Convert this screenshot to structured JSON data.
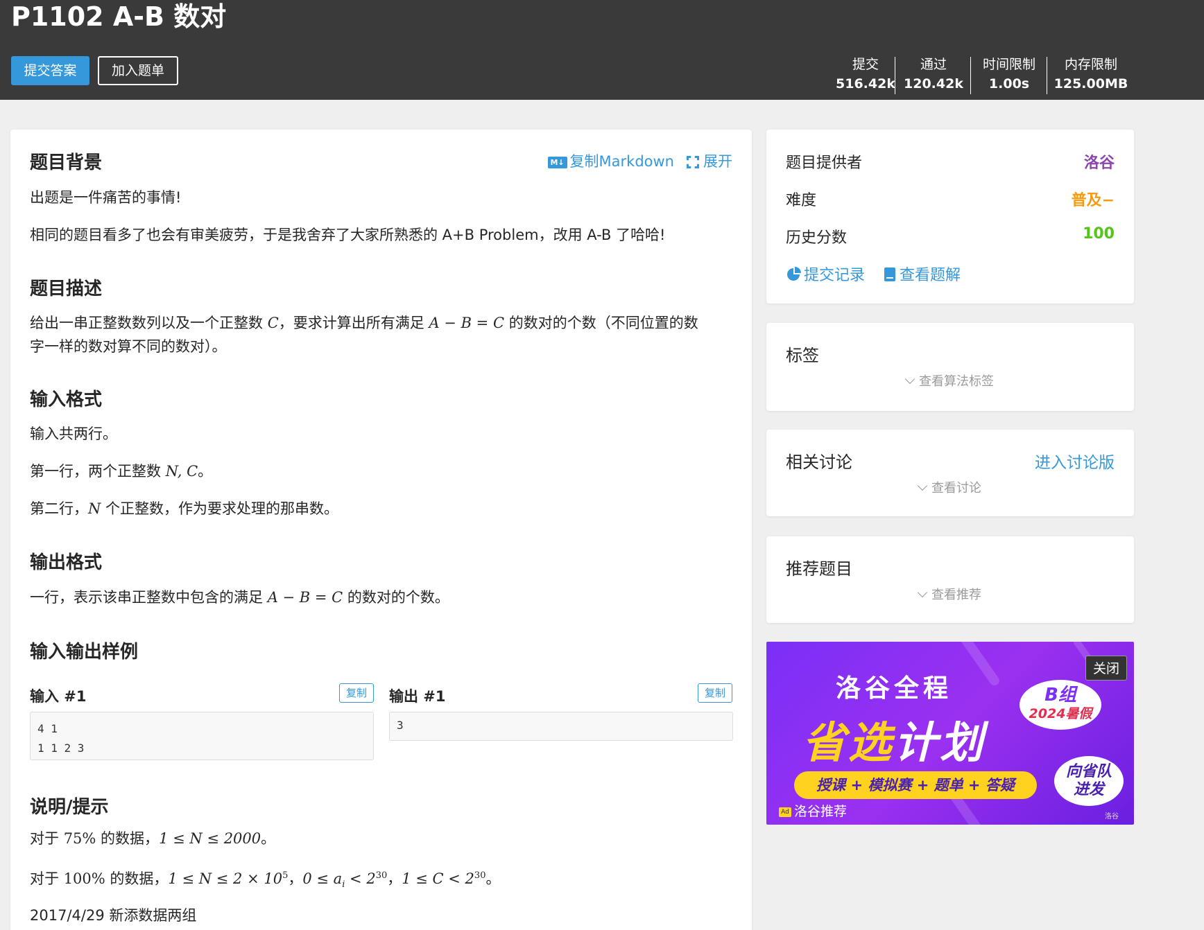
{
  "header": {
    "title": "P1102 A-B 数对",
    "submit_label": "提交答案",
    "add_label": "加入题单",
    "stats": [
      {
        "label": "提交",
        "value": "516.42k"
      },
      {
        "label": "通过",
        "value": "120.42k"
      },
      {
        "label": "时间限制",
        "value": "1.00s"
      },
      {
        "label": "内存限制",
        "value": "125.00MB"
      }
    ]
  },
  "main": {
    "copy_markdown": "复制Markdown",
    "expand": "展开",
    "md_icon": "M↓",
    "background_title": "题目背景",
    "background_p1": "出题是一件痛苦的事情!",
    "background_p2": "相同的题目看多了也会有审美疲劳，于是我舍弃了大家所熟悉的 A+B Problem，改用 A-B 了哈哈!",
    "desc_title": "题目描述",
    "desc_a": "给出一串正整数数列以及一个正整数 ",
    "desc_b": "，要求计算出所有满足 ",
    "desc_c": " 的数对的个数（不同位置的数",
    "desc_d": "字一样的数对算不同的数对）。",
    "input_title": "输入格式",
    "input_p1": "输入共两行。",
    "input_p2a": "第一行，两个正整数 ",
    "input_p2b": "。",
    "input_p3a": "第二行，",
    "input_p3b": " 个正整数，作为要求处理的那串数。",
    "output_title": "输出格式",
    "output_a": "一行，表示该串正整数中包含的满足 ",
    "output_b": " 的数对的个数。",
    "sample_title": "输入输出样例",
    "sample_in_label": "输入 #1",
    "sample_out_label": "输出 #1",
    "copy_label": "复制",
    "sample_in": "4 1\n1 1 2 3",
    "sample_out": "3",
    "hint_title": "说明/提示",
    "hint1_a": "对于 ",
    "hint1_b": " 的数据，",
    "hint1_c": "。",
    "hint2_a": "对于 ",
    "hint2_b": " 的数据，",
    "hint2_c": "，",
    "hint2_d": "，",
    "hint2_e": "。",
    "hint3": "2017/4/29 新添数据两组",
    "math": {
      "C": "C",
      "amb": "A − B = C",
      "NC": "N, C",
      "N": "N",
      "p75": "75%",
      "r1": "1 ≤ N ≤ 2000",
      "p100": "100%",
      "r2a": "1 ≤ N ≤ 2 × 10",
      "r2a_sup": "5",
      "r2b": "0 ≤ a",
      "r2b_sub": "i",
      "r2b2": " < 2",
      "r2b_sup": "30",
      "r2c": "1 ≤ C < 2",
      "r2c_sup": "30"
    }
  },
  "side": {
    "provider_label": "题目提供者",
    "provider_value": "洛谷",
    "difficulty_label": "难度",
    "difficulty_value": "普及−",
    "score_label": "历史分数",
    "score_value": "100",
    "records_link": "提交记录",
    "solutions_link": "查看题解",
    "tags_title": "标签",
    "tags_more": "查看算法标签",
    "discuss_title": "相关讨论",
    "discuss_link": "进入讨论版",
    "discuss_more": "查看讨论",
    "recommend_title": "推荐题目",
    "recommend_more": "查看推荐"
  },
  "ad": {
    "close": "关闭",
    "brand": "洛谷全程",
    "plan_a": "省选",
    "plan_b": "计划",
    "bar": "授课 + 模拟赛 + 题单 + 答疑",
    "bubble1_a": "B组",
    "bubble1_b": "2024暑假",
    "bubble2": "向省队\n进发",
    "rec": "洛谷推荐",
    "tag": "Ad",
    "small": "洛谷"
  },
  "colors": {
    "accent": "#3498db",
    "provider": "#8e44ad",
    "difficulty": "#f39c11",
    "score": "#52c41a",
    "header_bg": "#3a3a3a"
  }
}
